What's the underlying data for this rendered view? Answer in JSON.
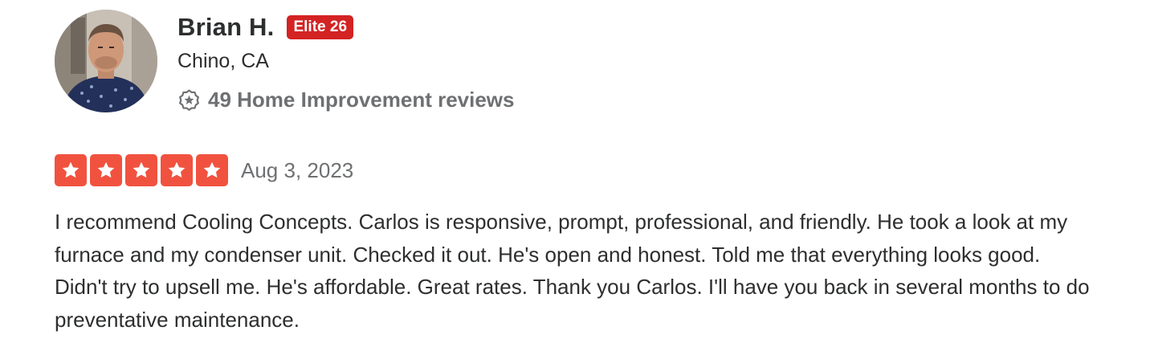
{
  "reviewer": {
    "name": "Brian H.",
    "badge": "Elite 26",
    "location": "Chino, CA",
    "review_count_text": "49 Home Improvement reviews",
    "avatar_icon": "user-photo"
  },
  "review": {
    "rating": 5,
    "max_rating": 5,
    "date": "Aug 3, 2023",
    "text": "I recommend Cooling Concepts. Carlos is responsive, prompt, professional, and friendly. He took a look at my furnace and my condenser unit. Checked it out. He's open and honest. Told me that everything looks good. Didn't try to upsell me. He's affordable. Great rates. Thank you Carlos. I'll have you back in several months to do preventative maintenance."
  },
  "colors": {
    "star_fill": "#f1523f",
    "badge_bg": "#d32323",
    "text_primary": "#2d2e2f",
    "text_secondary": "#6e7072"
  },
  "icons": {
    "stats": "review-badge-icon",
    "star": "star-icon"
  }
}
